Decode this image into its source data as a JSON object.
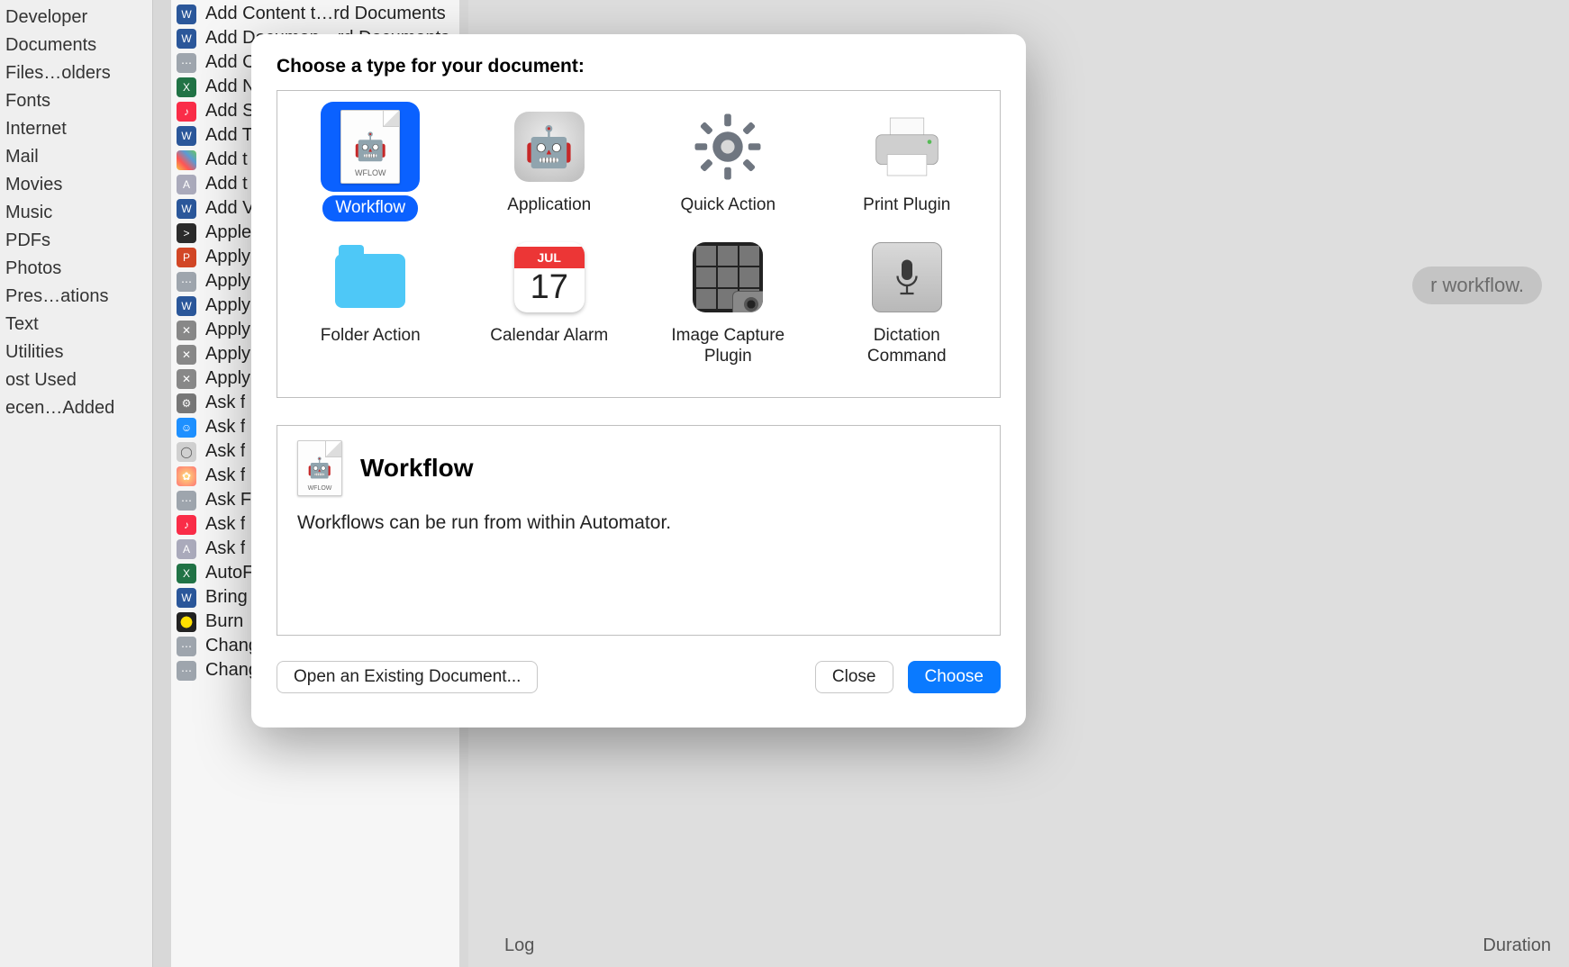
{
  "sidebar_categories": [
    "Developer",
    "Documents",
    "Files…olders",
    "Fonts",
    "Internet",
    "Mail",
    "Movies",
    "Music",
    "PDFs",
    "Photos",
    "Pres…ations",
    "Text",
    "Utilities",
    "ost Used",
    "ecen…Added"
  ],
  "actions_list": [
    {
      "icon": "word",
      "label": "Add Content t…rd Documents"
    },
    {
      "icon": "word",
      "label": "Add Documen…rd Documents"
    },
    {
      "icon": "misc",
      "label": "Add C"
    },
    {
      "icon": "excel",
      "label": "Add N"
    },
    {
      "icon": "music",
      "label": "Add S"
    },
    {
      "icon": "word",
      "label": "Add T"
    },
    {
      "icon": "photos",
      "label": "Add t"
    },
    {
      "icon": "txt",
      "label": "Add t"
    },
    {
      "icon": "word",
      "label": "Add V"
    },
    {
      "icon": "term",
      "label": "Apple"
    },
    {
      "icon": "ppt",
      "label": "Apply"
    },
    {
      "icon": "misc",
      "label": "Apply"
    },
    {
      "icon": "word",
      "label": "Apply"
    },
    {
      "icon": "hammer",
      "label": "Apply"
    },
    {
      "icon": "hammer",
      "label": "Apply"
    },
    {
      "icon": "hammer",
      "label": "Apply"
    },
    {
      "icon": "gear",
      "label": "Ask f"
    },
    {
      "icon": "finder",
      "label": "Ask f"
    },
    {
      "icon": "sphere",
      "label": "Ask f"
    },
    {
      "icon": "flower",
      "label": "Ask f"
    },
    {
      "icon": "misc",
      "label": "Ask F"
    },
    {
      "icon": "music",
      "label": "Ask f"
    },
    {
      "icon": "txt",
      "label": "Ask f"
    },
    {
      "icon": "excel",
      "label": "AutoF"
    },
    {
      "icon": "word",
      "label": "Bring"
    },
    {
      "icon": "burn",
      "label": "Burn"
    },
    {
      "icon": "misc",
      "label": "Change System Appearance"
    },
    {
      "icon": "misc",
      "label": "Change Type of Images"
    }
  ],
  "workflow_hint_pill": "r workflow.",
  "log_label": "Log",
  "duration_label": "Duration",
  "dialog": {
    "title": "Choose a type for your document:",
    "types": [
      {
        "key": "workflow",
        "label": "Workflow"
      },
      {
        "key": "application",
        "label": "Application"
      },
      {
        "key": "quick-action",
        "label": "Quick Action"
      },
      {
        "key": "print-plugin",
        "label": "Print Plugin"
      },
      {
        "key": "folder-action",
        "label": "Folder Action"
      },
      {
        "key": "calendar-alarm",
        "label": "Calendar Alarm"
      },
      {
        "key": "image-capture-plugin",
        "label": "Image Capture Plugin"
      },
      {
        "key": "dictation-command",
        "label": "Dictation Command"
      }
    ],
    "calendar_month": "JUL",
    "calendar_day": "17",
    "selected_type": "workflow",
    "desc_title": "Workflow",
    "desc_text": "Workflows can be run from within Automator.",
    "doc_tag": "WFLOW",
    "buttons": {
      "open": "Open an Existing Document...",
      "close": "Close",
      "choose": "Choose"
    }
  }
}
